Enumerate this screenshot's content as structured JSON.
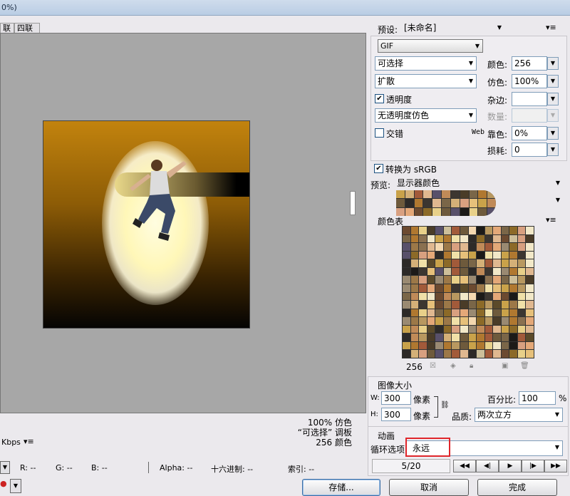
{
  "window": {
    "title": "0%)"
  },
  "tabs": [
    {
      "label": "联"
    },
    {
      "label": "四联"
    }
  ],
  "status": {
    "quality": "100% 仿色",
    "palette_line": "“可选择” 调板",
    "colors_line": "256 颜色",
    "kbps": "Kbps"
  },
  "info": {
    "r": "R: --",
    "g": "G: --",
    "b": "B: --",
    "alpha": "Alpha: --",
    "hex": "十六进制: --",
    "index": "索引: --"
  },
  "preset": {
    "label": "预设:",
    "value": "[未命名]"
  },
  "format": {
    "value": "GIF"
  },
  "reduction": {
    "value": "可选择"
  },
  "dither_algo": {
    "value": "扩散"
  },
  "transparency": {
    "label": "透明度",
    "checked": true
  },
  "trans_dither": {
    "value": "无透明度仿色"
  },
  "interlaced": {
    "label": "交错",
    "checked": false
  },
  "colors": {
    "label": "颜色:",
    "value": "256"
  },
  "dither": {
    "label": "仿色:",
    "value": "100%"
  },
  "matte": {
    "label": "杂边:",
    "value": ""
  },
  "amount": {
    "label": "数量:",
    "value": ""
  },
  "web_snap": {
    "prefix": "Web",
    "label": "靠色:",
    "value": "0%"
  },
  "lossy": {
    "label": "损耗:",
    "value": "0"
  },
  "convert_srgb": {
    "label": "转换为 sRGB",
    "checked": true
  },
  "preview_mode": {
    "label": "预览:",
    "value": "显示器颜色"
  },
  "color_table": {
    "label": "颜色表",
    "count": "256"
  },
  "image_size": {
    "label": "图像大小",
    "w_label": "W:",
    "w_value": "300",
    "h_label": "H:",
    "h_value": "300",
    "unit": "像素",
    "percent_label": "百分比:",
    "percent_value": "100",
    "percent_unit": "%",
    "quality_label": "品质:",
    "quality_value": "两次立方"
  },
  "animation": {
    "label": "动画",
    "loop_label": "循环选项",
    "loop_value": "永远",
    "frame": "5/20"
  },
  "buttons": {
    "save": "存储...",
    "cancel": "取消",
    "done": "完成"
  },
  "colors_accent": {
    "highlight": "#e0262b"
  }
}
